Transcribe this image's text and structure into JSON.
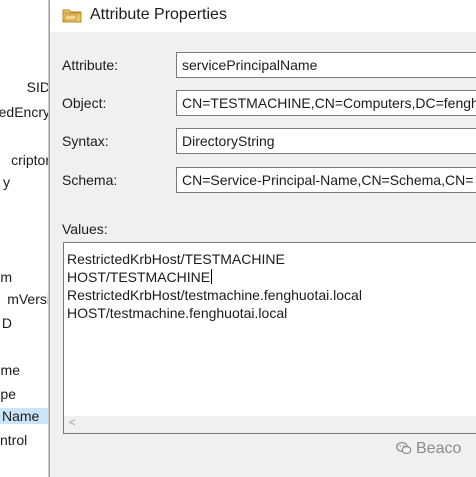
{
  "background_list": {
    "items": [
      "SID",
      "edEncry",
      "criptor",
      "y",
      "m",
      "mVersi",
      "D",
      "me",
      "pe",
      "Name",
      "ntrol"
    ],
    "selected_index": 9
  },
  "dialog": {
    "title": "Attribute Properties",
    "fields": [
      {
        "label": "Attribute:",
        "value": "servicePrincipalName"
      },
      {
        "label": "Object:",
        "value": "CN=TESTMACHINE,CN=Computers,DC=fenghuotai"
      },
      {
        "label": "Syntax:",
        "value": "DirectoryString"
      },
      {
        "label": "Schema:",
        "value": "CN=Service-Principal-Name,CN=Schema,CN="
      }
    ],
    "values_label": "Values:",
    "values": [
      "RestrictedKrbHost/TESTMACHINE",
      "HOST/TESTMACHINE",
      "RestrictedKrbHost/testmachine.fenghuotai.local",
      "HOST/testmachine.fenghuotai.local"
    ],
    "scroll_left_glyph": "<"
  },
  "watermark": {
    "text": "Beaco",
    "icon": "wechat-icon"
  }
}
